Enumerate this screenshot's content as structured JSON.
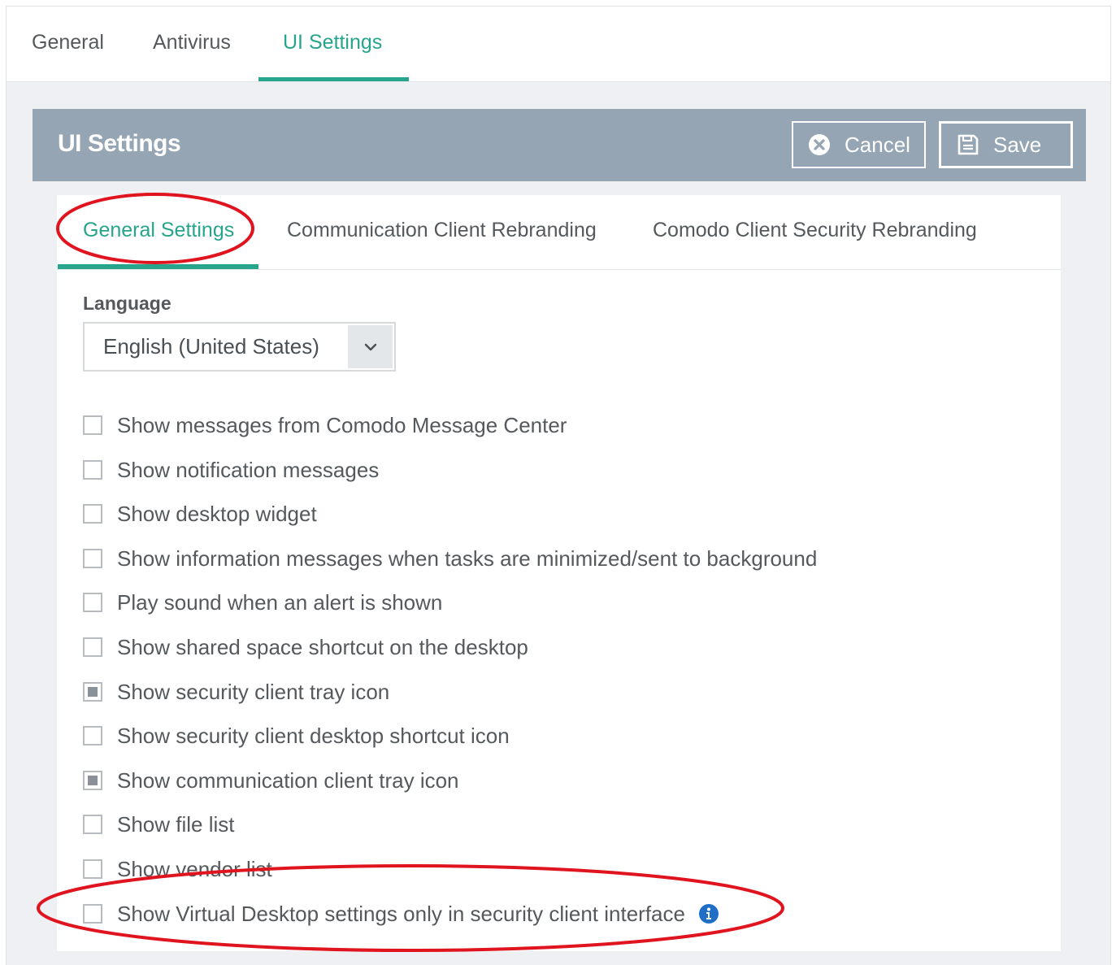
{
  "top_tabs": [
    {
      "label": "General",
      "active": false
    },
    {
      "label": "Antivirus",
      "active": false
    },
    {
      "label": "UI Settings",
      "active": true
    }
  ],
  "panel": {
    "title": "UI Settings",
    "cancel_label": "Cancel",
    "save_label": "Save"
  },
  "sub_tabs": [
    {
      "label": "General Settings",
      "active": true
    },
    {
      "label": "Communication Client Rebranding",
      "active": false
    },
    {
      "label": "Comodo Client Security Rebranding",
      "active": false
    }
  ],
  "language": {
    "label": "Language",
    "value": "English (United States)"
  },
  "options": [
    {
      "label": "Show messages from Comodo Message Center",
      "checked": false
    },
    {
      "label": "Show notification messages",
      "checked": false
    },
    {
      "label": "Show desktop widget",
      "checked": false
    },
    {
      "label": "Show information messages when tasks are minimized/sent to background",
      "checked": false
    },
    {
      "label": "Play sound when an alert is shown",
      "checked": false
    },
    {
      "label": "Show shared space shortcut on the desktop",
      "checked": false
    },
    {
      "label": "Show security client tray icon",
      "checked": true
    },
    {
      "label": "Show security client desktop shortcut icon",
      "checked": false
    },
    {
      "label": "Show communication client tray icon",
      "checked": true
    },
    {
      "label": "Show file list",
      "checked": false
    },
    {
      "label": "Show vendor list",
      "checked": false
    },
    {
      "label": "Show Virtual Desktop settings only in security client interface",
      "checked": false,
      "info": true
    }
  ],
  "colors": {
    "accent": "#27a58c",
    "header_bg": "#95a5b4",
    "annotation": "#e0141e",
    "info_icon": "#1f6fc7"
  },
  "icons": {
    "cancel": "close-circle-icon",
    "save": "floppy-disk-icon",
    "dropdown": "chevron-down-icon",
    "info": "info-icon"
  }
}
